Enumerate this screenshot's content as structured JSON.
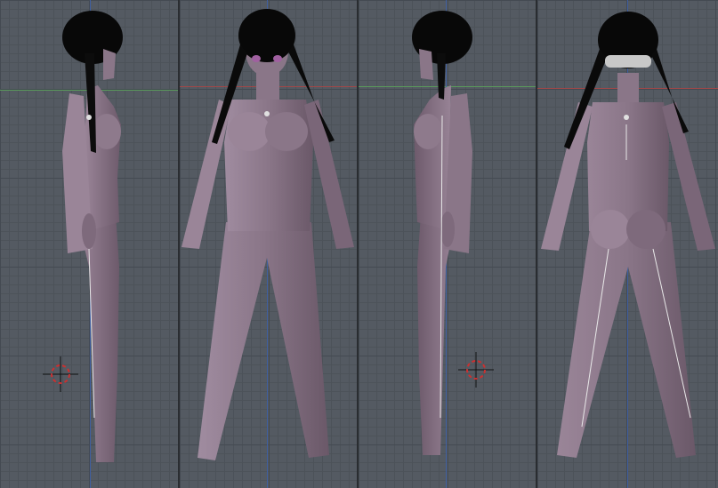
{
  "viewports": [
    {
      "id": "left",
      "view": "side-left"
    },
    {
      "id": "front",
      "view": "front"
    },
    {
      "id": "right",
      "view": "side-right"
    },
    {
      "id": "back",
      "view": "back"
    }
  ],
  "colors": {
    "grid_bg": "#545a62",
    "x_axis_green": "#5a9a5a",
    "x_axis_red": "#a04848",
    "z_axis_blue": "#3f5fa0",
    "skin": "#8a7688",
    "hair": "#080808",
    "cursor_red": "#cc3030"
  },
  "icons": [
    "3d-cursor-icon"
  ]
}
